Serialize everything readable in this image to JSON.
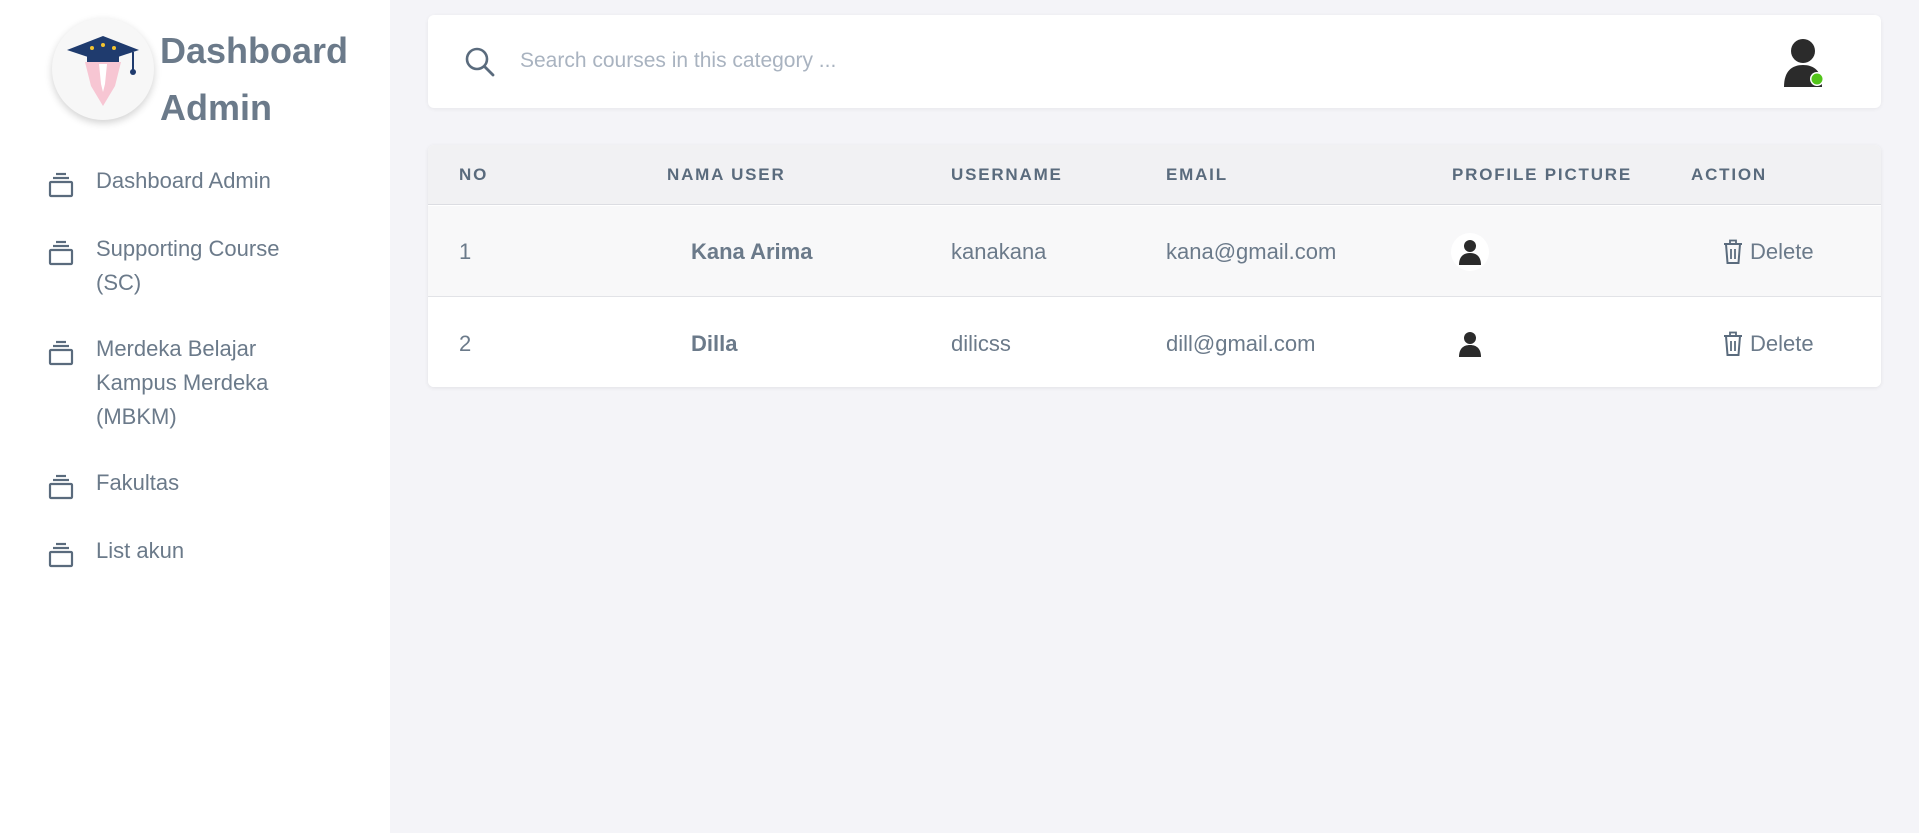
{
  "sidebar": {
    "brand_title": "Dashboard Admin",
    "items": [
      {
        "label": "Dashboard Admin",
        "icon": "stack-icon"
      },
      {
        "label": "Supporting Course (SC)",
        "icon": "stack-icon"
      },
      {
        "label": "Merdeka Belajar Kampus Merdeka (MBKM)",
        "icon": "stack-icon"
      },
      {
        "label": "Fakultas",
        "icon": "stack-icon"
      },
      {
        "label": "List akun",
        "icon": "stack-icon"
      }
    ]
  },
  "header": {
    "search_placeholder": "Search courses in this category ...",
    "user_status_color": "#52c41a"
  },
  "table": {
    "columns": [
      "NO",
      "NAMA USER",
      "USERNAME",
      "EMAIL",
      "PROFILE PICTURE",
      "ACTION"
    ],
    "rows": [
      {
        "no": "1",
        "name": "Kana Arima",
        "username": "kanakana",
        "email": "kana@gmail.com",
        "action": "Delete"
      },
      {
        "no": "2",
        "name": "Dilla",
        "username": "dilicss",
        "email": "dill@gmail.com",
        "action": "Delete"
      }
    ]
  }
}
